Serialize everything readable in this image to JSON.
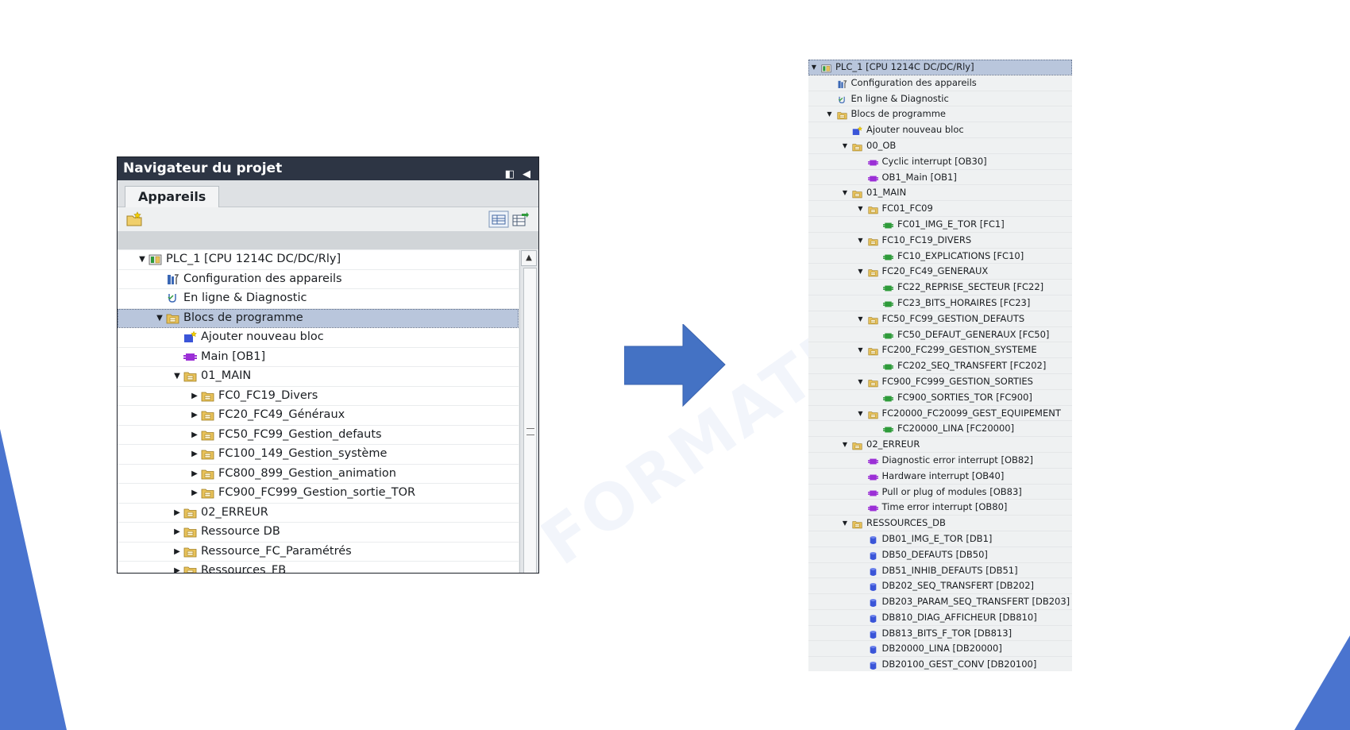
{
  "watermark": "FORMATION",
  "navigator": {
    "title": "Navigateur du projet",
    "tab": "Appareils",
    "tree": [
      {
        "label": "PLC_1 [CPU 1214C DC/DC/Rly]",
        "level": 0,
        "toggle": "open",
        "icon": "plc"
      },
      {
        "label": "Configuration des appareils",
        "level": 1,
        "toggle": "none",
        "icon": "config"
      },
      {
        "label": "En ligne & Diagnostic",
        "level": 1,
        "toggle": "none",
        "icon": "diag"
      },
      {
        "label": "Blocs de programme",
        "level": 1,
        "toggle": "open",
        "icon": "folder-blocks",
        "selected": true
      },
      {
        "label": "Ajouter nouveau bloc",
        "level": 2,
        "toggle": "none",
        "icon": "add-block"
      },
      {
        "label": "Main [OB1]",
        "level": 2,
        "toggle": "none",
        "icon": "ob"
      },
      {
        "label": "01_MAIN",
        "level": 2,
        "toggle": "open",
        "icon": "folder"
      },
      {
        "label": "FC0_FC19_Divers",
        "level": 3,
        "toggle": "closed",
        "icon": "folder"
      },
      {
        "label": "FC20_FC49_Généraux",
        "level": 3,
        "toggle": "closed",
        "icon": "folder"
      },
      {
        "label": "FC50_FC99_Gestion_defauts",
        "level": 3,
        "toggle": "closed",
        "icon": "folder"
      },
      {
        "label": "FC100_149_Gestion_système",
        "level": 3,
        "toggle": "closed",
        "icon": "folder"
      },
      {
        "label": "FC800_899_Gestion_animation",
        "level": 3,
        "toggle": "closed",
        "icon": "folder"
      },
      {
        "label": "FC900_FC999_Gestion_sortie_TOR",
        "level": 3,
        "toggle": "closed",
        "icon": "folder"
      },
      {
        "label": "02_ERREUR",
        "level": 2,
        "toggle": "closed",
        "icon": "folder"
      },
      {
        "label": "Ressource DB",
        "level": 2,
        "toggle": "closed",
        "icon": "folder"
      },
      {
        "label": "Ressource_FC_Paramétrés",
        "level": 2,
        "toggle": "closed",
        "icon": "folder"
      },
      {
        "label": "Ressources_FB",
        "level": 2,
        "toggle": "closed",
        "icon": "folder"
      }
    ]
  },
  "right_tree": [
    {
      "label": "PLC_1 [CPU 1214C DC/DC/Rly]",
      "level": 0,
      "toggle": "open",
      "icon": "plc",
      "selected": true
    },
    {
      "label": "Configuration des appareils",
      "level": 1,
      "toggle": "none",
      "icon": "config"
    },
    {
      "label": "En ligne & Diagnostic",
      "level": 1,
      "toggle": "none",
      "icon": "diag"
    },
    {
      "label": "Blocs de programme",
      "level": 1,
      "toggle": "open",
      "icon": "folder-blocks"
    },
    {
      "label": "Ajouter nouveau bloc",
      "level": 2,
      "toggle": "none",
      "icon": "add-block"
    },
    {
      "label": "00_OB",
      "level": 2,
      "toggle": "open",
      "icon": "folder"
    },
    {
      "label": "Cyclic interrupt [OB30]",
      "level": 3,
      "toggle": "none",
      "icon": "ob"
    },
    {
      "label": "OB1_Main [OB1]",
      "level": 3,
      "toggle": "none",
      "icon": "ob"
    },
    {
      "label": "01_MAIN",
      "level": 2,
      "toggle": "open",
      "icon": "folder"
    },
    {
      "label": "FC01_FC09",
      "level": 3,
      "toggle": "open",
      "icon": "folder"
    },
    {
      "label": "FC01_IMG_E_TOR [FC1]",
      "level": 4,
      "toggle": "none",
      "icon": "fc"
    },
    {
      "label": "FC10_FC19_DIVERS",
      "level": 3,
      "toggle": "open",
      "icon": "folder"
    },
    {
      "label": "FC10_EXPLICATIONS [FC10]",
      "level": 4,
      "toggle": "none",
      "icon": "fc"
    },
    {
      "label": "FC20_FC49_GENERAUX",
      "level": 3,
      "toggle": "open",
      "icon": "folder"
    },
    {
      "label": "FC22_REPRISE_SECTEUR [FC22]",
      "level": 4,
      "toggle": "none",
      "icon": "fc"
    },
    {
      "label": "FC23_BITS_HORAIRES [FC23]",
      "level": 4,
      "toggle": "none",
      "icon": "fc"
    },
    {
      "label": "FC50_FC99_GESTION_DEFAUTS",
      "level": 3,
      "toggle": "open",
      "icon": "folder"
    },
    {
      "label": "FC50_DEFAUT_GENERAUX [FC50]",
      "level": 4,
      "toggle": "none",
      "icon": "fc"
    },
    {
      "label": "FC200_FC299_GESTION_SYSTEME",
      "level": 3,
      "toggle": "open",
      "icon": "folder"
    },
    {
      "label": "FC202_SEQ_TRANSFERT [FC202]",
      "level": 4,
      "toggle": "none",
      "icon": "fc"
    },
    {
      "label": "FC900_FC999_GESTION_SORTIES",
      "level": 3,
      "toggle": "open",
      "icon": "folder"
    },
    {
      "label": "FC900_SORTIES_TOR [FC900]",
      "level": 4,
      "toggle": "none",
      "icon": "fc"
    },
    {
      "label": "FC20000_FC20099_GEST_EQUIPEMENT",
      "level": 3,
      "toggle": "open",
      "icon": "folder"
    },
    {
      "label": "FC20000_LINA [FC20000]",
      "level": 4,
      "toggle": "none",
      "icon": "fc"
    },
    {
      "label": "02_ERREUR",
      "level": 2,
      "toggle": "open",
      "icon": "folder"
    },
    {
      "label": "Diagnostic error interrupt [OB82]",
      "level": 3,
      "toggle": "none",
      "icon": "ob"
    },
    {
      "label": "Hardware interrupt [OB40]",
      "level": 3,
      "toggle": "none",
      "icon": "ob"
    },
    {
      "label": "Pull or plug of modules [OB83]",
      "level": 3,
      "toggle": "none",
      "icon": "ob"
    },
    {
      "label": "Time error interrupt [OB80]",
      "level": 3,
      "toggle": "none",
      "icon": "ob"
    },
    {
      "label": "RESSOURCES_DB",
      "level": 2,
      "toggle": "open",
      "icon": "folder"
    },
    {
      "label": "DB01_IMG_E_TOR [DB1]",
      "level": 3,
      "toggle": "none",
      "icon": "db"
    },
    {
      "label": "DB50_DEFAUTS [DB50]",
      "level": 3,
      "toggle": "none",
      "icon": "db"
    },
    {
      "label": "DB51_INHIB_DEFAUTS [DB51]",
      "level": 3,
      "toggle": "none",
      "icon": "db"
    },
    {
      "label": "DB202_SEQ_TRANSFERT [DB202]",
      "level": 3,
      "toggle": "none",
      "icon": "db"
    },
    {
      "label": "DB203_PARAM_SEQ_TRANSFERT [DB203]",
      "level": 3,
      "toggle": "none",
      "icon": "db"
    },
    {
      "label": "DB810_DIAG_AFFICHEUR [DB810]",
      "level": 3,
      "toggle": "none",
      "icon": "db"
    },
    {
      "label": "DB813_BITS_F_TOR [DB813]",
      "level": 3,
      "toggle": "none",
      "icon": "db"
    },
    {
      "label": "DB20000_LINA [DB20000]",
      "level": 3,
      "toggle": "none",
      "icon": "db"
    },
    {
      "label": "DB20100_GEST_CONV [DB20100]",
      "level": 3,
      "toggle": "none",
      "icon": "db"
    }
  ],
  "colors": {
    "accent_blue": "#4472c4",
    "header_dark": "#2d3544",
    "selection": "#b9c6dc",
    "ob_purple": "#9b2fd6",
    "fc_green": "#2e9b3a",
    "db_blue": "#3a55d8",
    "folder_yellow": "#e8c25a"
  }
}
